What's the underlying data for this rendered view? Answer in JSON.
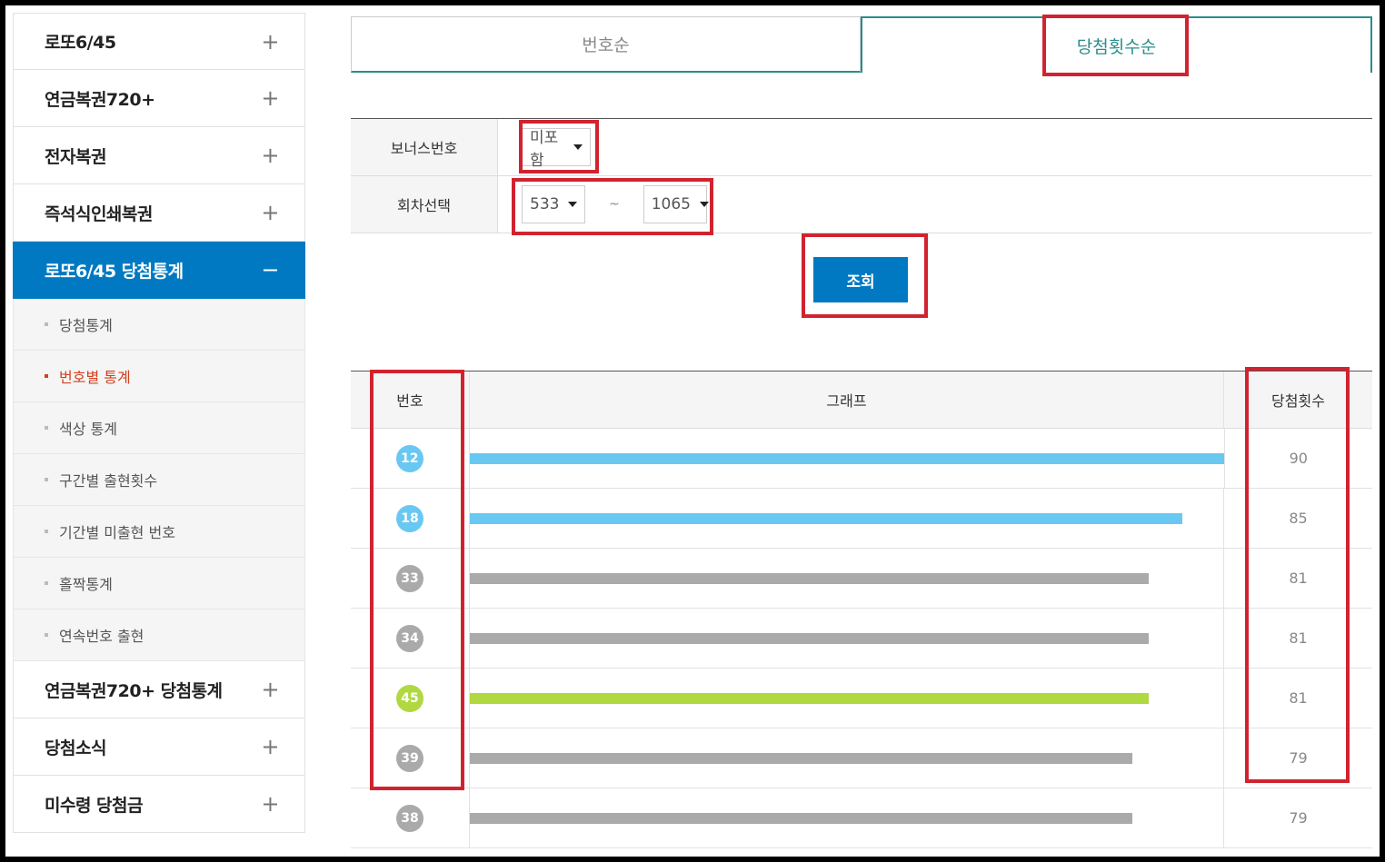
{
  "sidebar": {
    "menu_top": [
      {
        "label": "로또6/45",
        "toggle": "+"
      },
      {
        "label": "연금복권720+",
        "toggle": "+"
      },
      {
        "label": "전자복권",
        "toggle": "+"
      },
      {
        "label": "즉석식인쇄복권",
        "toggle": "+"
      }
    ],
    "active": {
      "label": "로또6/45 당첨통계",
      "toggle": "−"
    },
    "submenu": [
      {
        "label": "당첨통계"
      },
      {
        "label": "번호별 통계"
      },
      {
        "label": "색상 통계"
      },
      {
        "label": "구간별 출현횟수"
      },
      {
        "label": "기간별 미출현 번호"
      },
      {
        "label": "홀짝통계"
      },
      {
        "label": "연속번호 출현"
      }
    ],
    "menu_bottom": [
      {
        "label": "연금복권720+ 당첨통계",
        "toggle": "+"
      },
      {
        "label": "당첨소식",
        "toggle": "+"
      },
      {
        "label": "미수령 당첨금",
        "toggle": "+"
      }
    ]
  },
  "tabs": {
    "by_number": "번호순",
    "by_wins": "당첨횟수순"
  },
  "form": {
    "bonus_label": "보너스번호",
    "bonus_value": "미포함",
    "round_label": "회차선택",
    "round_from": "533",
    "round_sep": "~",
    "round_to": "1065"
  },
  "search_button": "조회",
  "table": {
    "headers": {
      "number": "번호",
      "graph": "그래프",
      "count": "당첨횟수"
    },
    "max_count": 90,
    "rows": [
      {
        "number": "12",
        "count": 90,
        "color": "#69c8f2"
      },
      {
        "number": "18",
        "count": 85,
        "color": "#69c8f2"
      },
      {
        "number": "33",
        "count": 81,
        "color": "#aaaaaa"
      },
      {
        "number": "34",
        "count": 81,
        "color": "#aaaaaa"
      },
      {
        "number": "45",
        "count": 81,
        "color": "#b0d840"
      },
      {
        "number": "39",
        "count": 79,
        "color": "#aaaaaa"
      },
      {
        "number": "38",
        "count": 79,
        "color": "#aaaaaa"
      }
    ]
  }
}
